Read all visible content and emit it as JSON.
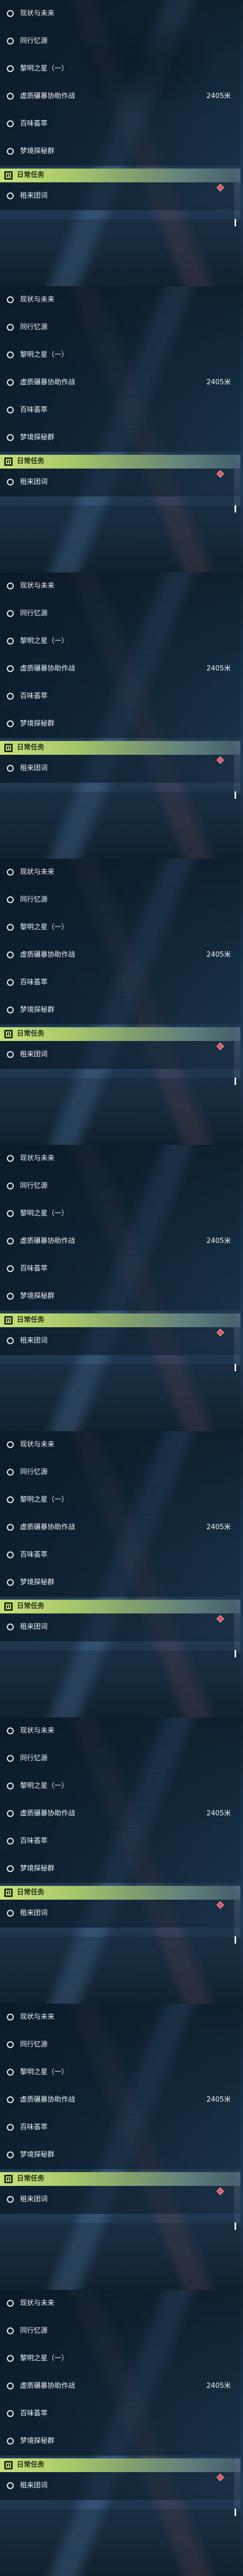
{
  "quests": [
    {
      "label": "现状与未来",
      "value": ""
    },
    {
      "label": "同行忆源",
      "value": ""
    },
    {
      "label": "黎明之星（一）",
      "value": ""
    },
    {
      "label": "虚质碾暴协助作战",
      "value": "2405米"
    },
    {
      "label": "百味荟萃",
      "value": ""
    },
    {
      "label": "梦境探秘群",
      "value": ""
    }
  ],
  "daily": {
    "title": "日常任务",
    "item": "租来团词"
  },
  "colors": {
    "accent": "#c8e27a",
    "marker": "#e0525c"
  },
  "icons": {
    "quest_marker": "ring-icon",
    "daily_badge": "task-badge-icon",
    "alert": "diamond-icon"
  }
}
